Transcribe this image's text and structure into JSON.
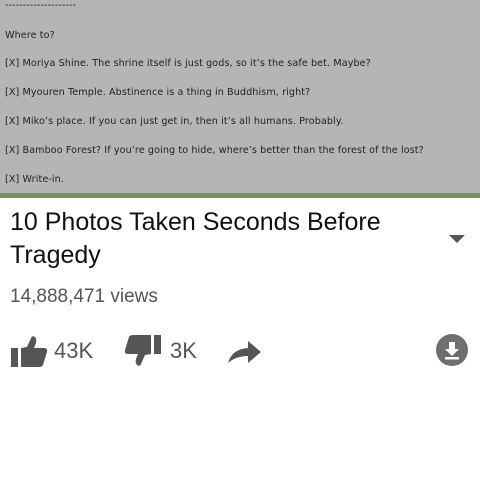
{
  "quest": {
    "divider": "--------------------",
    "prompt": "Where to?",
    "options": [
      "[X] Moriya Shine. The shrine itself is just gods, so it’s the safe bet. Maybe?",
      "[X] Myouren Temple. Abstinence is a thing in Buddhism, right?",
      "[X] Miko’s place. If you can just get in, then it’s all humans. Probably.",
      "[X] Bamboo Forest? If you’re going to hide, where’s better than the forest of the lost?",
      "[X] Write-in."
    ]
  },
  "video": {
    "title": "10 Photos Taken Seconds Before Tragedy",
    "views": "14,888,471 views",
    "likes": "43K",
    "dislikes": "3K"
  },
  "icons": {
    "expand": "chevron-down-icon",
    "like": "thumbs-up-icon",
    "dislike": "thumbs-down-icon",
    "share": "share-arrow-icon",
    "download": "download-icon"
  },
  "colors": {
    "quest_background": "#b5b5b5",
    "icon_gray": "#555555",
    "download_circle": "#6e6e6e"
  }
}
